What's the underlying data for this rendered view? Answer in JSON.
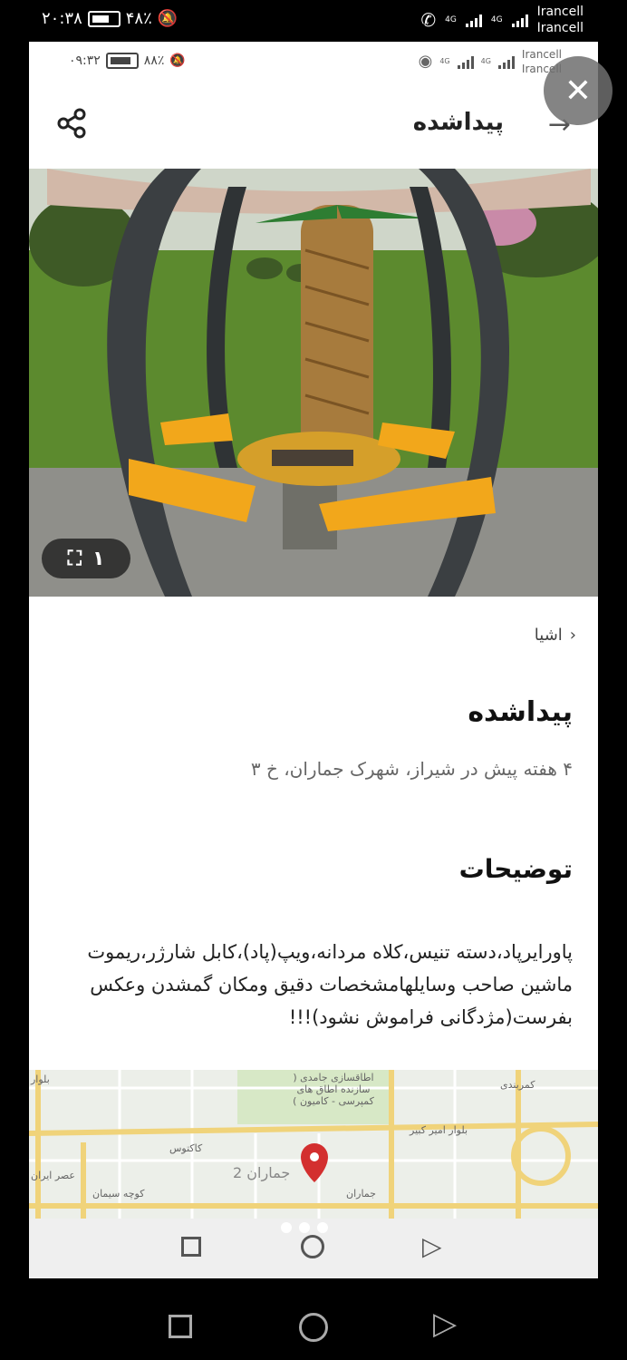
{
  "outer_status": {
    "time": "۲۰:۳۸",
    "battery": "۴۸٪",
    "network1": "4G",
    "network2": "4G",
    "carrier1": "Irancell",
    "carrier2": "Irancell"
  },
  "inner_status": {
    "time": "۰۹:۳۲",
    "battery": "۸۸٪",
    "network1": "4G",
    "network2": "4G",
    "carrier1": "Irancell",
    "carrier2": "Irancell"
  },
  "header": {
    "title": "پیداشده",
    "back_icon": "arrow-right-icon",
    "share_icon": "share-icon"
  },
  "close_icon": "close-icon",
  "image": {
    "counter": "۱",
    "fullscreen_icon": "fullscreen-icon"
  },
  "breadcrumb": {
    "label": "اشیا",
    "chevron": "chevron-left-icon"
  },
  "post": {
    "title": "پیداشده",
    "meta": "۴ هفته پیش در شیراز، شهرک جماران، خ ۳",
    "section_title": "توضیحات",
    "description": "پاورایرپاد،دسته تنیس،کلاه مردانه،ویپ(پاد)،کابل شارژر،ریموت ماشین صاحب وسایلهامشخصات دقیق ومکان گمشدن وعکس بفرست(مژدگانی فراموش نشود)!!!"
  },
  "map": {
    "poi1": "اطاقسازی جامدی ( سازنده اطاق های کمپرسی - کامیون )",
    "poi2": "کاکتوس",
    "poi3": "جماران 2",
    "poi4": "بلوار امیر کبیر",
    "poi5": "جماران",
    "poi6": "عصر ایران",
    "poi7": "کوچه سیمان",
    "poi8": "کمربندی",
    "poi9": "بلوار",
    "pin_color": "#d32f2f"
  },
  "colors": {
    "accent": "#d32f2f",
    "bench": "#f2a71b"
  }
}
